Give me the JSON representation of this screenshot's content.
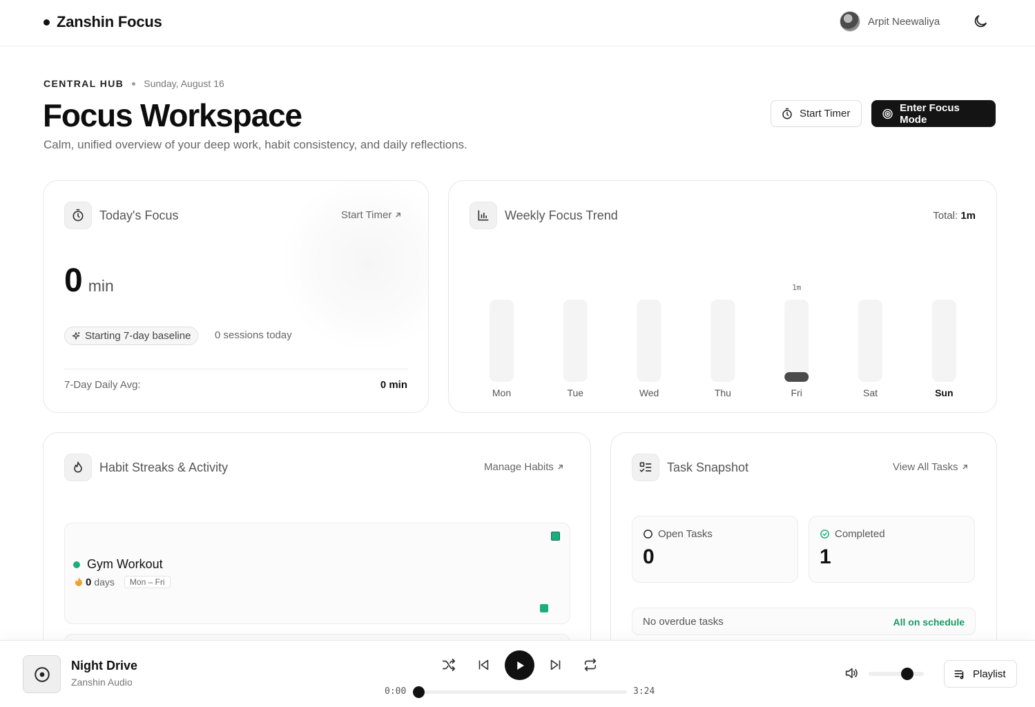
{
  "header": {
    "brand": "Zanshin Focus",
    "user_name": "Arpit Neewaliya",
    "theme_icon": "moon-icon"
  },
  "hero": {
    "eyebrow": "CENTRAL HUB",
    "date": "Sunday, August 16",
    "title": "Focus Workspace",
    "subtitle": "Calm, unified overview of your deep work, habit consistency, and daily reflections.",
    "start_timer_label": "Start Timer",
    "focus_mode_label": "Enter Focus Mode"
  },
  "today_focus": {
    "title": "Today's Focus",
    "link": "Start Timer",
    "value": "0",
    "unit": "min",
    "baseline_pill": "Starting 7-day baseline",
    "sessions": "0 sessions today",
    "avg_label": "7-Day Daily Avg:",
    "avg_value": "0 min"
  },
  "weekly_trend": {
    "title": "Weekly Focus Trend",
    "total_label": "Total:",
    "total_value": "1m"
  },
  "chart_data": {
    "type": "bar",
    "categories": [
      "Mon",
      "Tue",
      "Wed",
      "Thu",
      "Fri",
      "Sat",
      "Sun"
    ],
    "values": [
      0,
      0,
      0,
      0,
      1,
      0,
      0
    ],
    "value_labels": [
      "",
      "",
      "",
      "",
      "1m",
      "",
      ""
    ],
    "unit": "minutes",
    "highlight_category": "Sun",
    "ylim": [
      0,
      10
    ],
    "grid": false,
    "colors": {
      "track": "#f4f4f4",
      "bar": "#4a4a4a",
      "label": "#555555"
    }
  },
  "habits": {
    "title": "Habit Streaks & Activity",
    "link": "Manage Habits",
    "items": [
      {
        "name": "Gym Workout",
        "streak": "0",
        "streak_unit": "days",
        "schedule": "Mon – Fri",
        "color": "#1aae7e"
      }
    ]
  },
  "tasks": {
    "title": "Task Snapshot",
    "link": "View All Tasks",
    "open_label": "Open Tasks",
    "open_value": "0",
    "completed_label": "Completed",
    "completed_value": "1",
    "overdue_text": "No overdue tasks",
    "overdue_status": "All on schedule"
  },
  "player": {
    "track": "Night Drive",
    "artist": "Zanshin Audio",
    "elapsed": "0:00",
    "duration": "3:24",
    "progress": 0,
    "volume": 0.7,
    "playlist_label": "Playlist"
  }
}
